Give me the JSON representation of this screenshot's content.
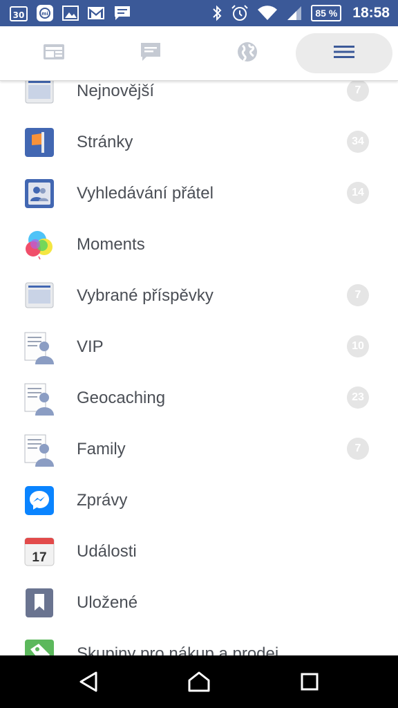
{
  "status_bar": {
    "date_badge": "30",
    "battery": "85 %",
    "time": "18:58",
    "icons": [
      "calendar-icon",
      "mi-icon",
      "image-icon",
      "gmail-icon",
      "message-icon",
      "bluetooth-icon",
      "alarm-icon",
      "wifi-icon",
      "signal-icon",
      "battery-icon"
    ]
  },
  "nav_tabs": [
    {
      "name": "news-feed",
      "icon": "news-feed-icon"
    },
    {
      "name": "messages",
      "icon": "chat-icon"
    },
    {
      "name": "notifications",
      "icon": "globe-icon"
    },
    {
      "name": "menu",
      "icon": "hamburger-icon",
      "active": true
    }
  ],
  "colors": {
    "brand": "#3b5998",
    "nav_active_bg": "#ebebeb",
    "label": "#4b4f56",
    "badge_bg": "#e5e5e5"
  },
  "menu_items": [
    {
      "label": "Nejnovější",
      "icon": "feed-icon",
      "badge": "7"
    },
    {
      "label": "Stránky",
      "icon": "pages-flag-icon",
      "badge": "34"
    },
    {
      "label": "Vyhledávání přátel",
      "icon": "find-friends-icon",
      "badge": "14"
    },
    {
      "label": "Moments",
      "icon": "moments-balloons-icon",
      "badge": ""
    },
    {
      "label": "Vybrané příspěvky",
      "icon": "feed-icon",
      "badge": "7"
    },
    {
      "label": "VIP",
      "icon": "friend-list-icon",
      "badge": "10"
    },
    {
      "label": "Geocaching",
      "icon": "friend-list-icon",
      "badge": "23"
    },
    {
      "label": "Family",
      "icon": "friend-list-icon",
      "badge": "7"
    },
    {
      "label": "Zprávy",
      "icon": "messenger-icon",
      "badge": ""
    },
    {
      "label": "Události",
      "icon": "calendar-17-icon",
      "badge": "",
      "icon_text": "17"
    },
    {
      "label": "Uložené",
      "icon": "bookmark-icon",
      "badge": ""
    },
    {
      "label": "Skupiny pro nákup a prodej",
      "icon": "tag-icon",
      "badge": ""
    }
  ],
  "android_nav": [
    "back-icon",
    "home-icon",
    "recents-icon"
  ]
}
